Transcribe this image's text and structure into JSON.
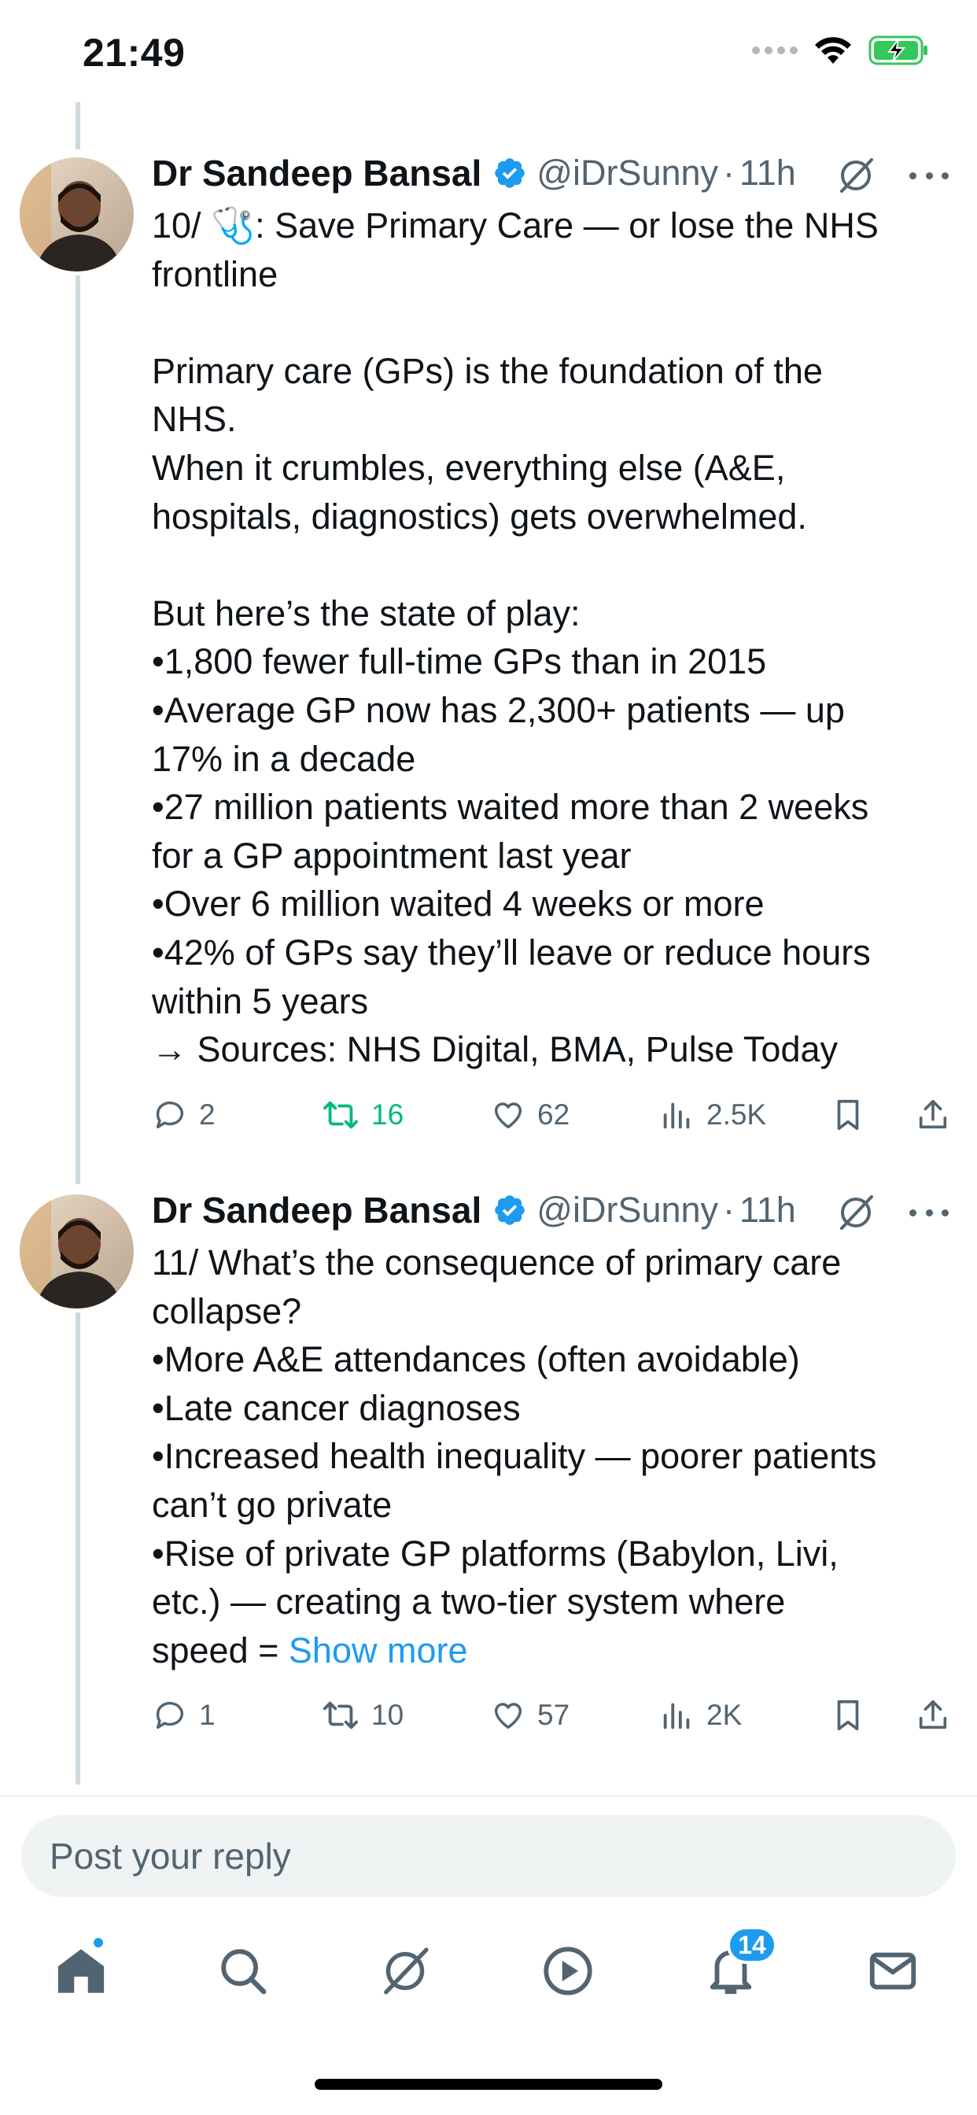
{
  "status_bar": {
    "time": "21:49"
  },
  "tweets": [
    {
      "author_name": "Dr Sandeep Bansal",
      "handle": "@iDrSunny",
      "separator": "·",
      "time_ago": "11h",
      "body_lines": [
        "10/ 🩺: Save Primary Care — or lose the NHS",
        "frontline",
        "",
        "Primary care (GPs) is the foundation of the",
        "NHS.",
        "When it crumbles, everything else (A&E,",
        "hospitals, diagnostics) gets overwhelmed.",
        "",
        "But here’s the state of play:",
        "•1,800 fewer full-time GPs than in 2015",
        "•Average GP now has 2,300+ patients — up",
        "17% in a decade",
        "•27 million patients waited more than 2 weeks",
        "for a GP appointment last year",
        "•Over 6 million waited 4 weeks or more",
        "•42% of GPs say they’ll leave or reduce hours",
        "within 5 years",
        "→ Sources: NHS Digital, BMA, Pulse Today"
      ],
      "stats": {
        "replies": "2",
        "reposts": "16",
        "likes": "62",
        "views": "2.5K"
      }
    },
    {
      "author_name": "Dr Sandeep Bansal",
      "handle": "@iDrSunny",
      "separator": "·",
      "time_ago": "11h",
      "body_lines": [
        "11/ What’s the consequence of primary care",
        "collapse?",
        "•More A&E attendances (often avoidable)",
        "•Late cancer diagnoses",
        "•Increased health inequality — poorer patients",
        "can’t go private",
        "•Rise of private GP platforms (Babylon, Livi,",
        "etc.) — creating a two-tier system where"
      ],
      "last_line_text": "speed = ",
      "show_more": "Show more",
      "stats": {
        "replies": "1",
        "reposts": "10",
        "likes": "57",
        "views": "2K"
      }
    }
  ],
  "reply": {
    "placeholder": "Post your reply"
  },
  "tab_bar": {
    "items": [
      "home-icon",
      "search-icon",
      "grok-icon",
      "video-icon",
      "notifications-icon",
      "messages-icon"
    ],
    "notifications_badge": "14"
  },
  "colors": {
    "accent": "#1d9bf0",
    "repost_active": "#00ba7c",
    "secondary_text": "#536471",
    "thread_line": "#cfd9de"
  }
}
